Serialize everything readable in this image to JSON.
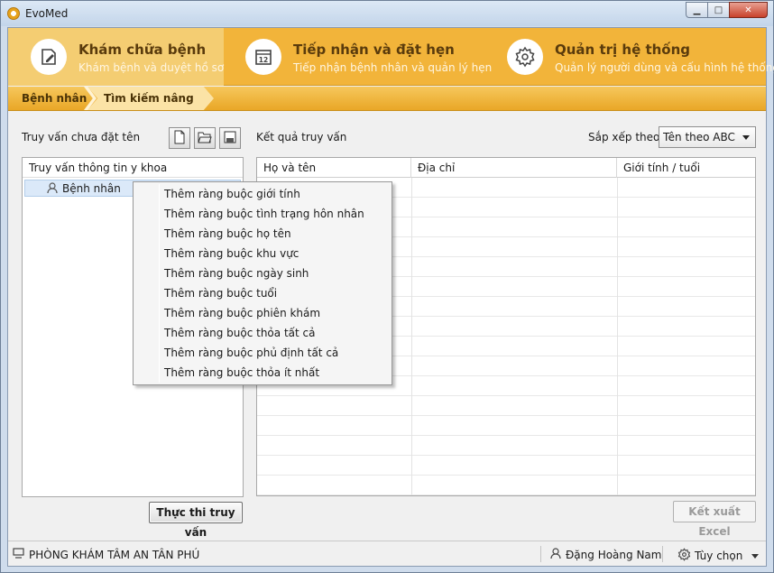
{
  "window": {
    "title": "EvoMed",
    "minimize": "▁",
    "maximize": "□",
    "close": "✕"
  },
  "modules": [
    {
      "title": "Khám chữa bệnh",
      "subtitle": "Khám bệnh và duyệt hồ sơ",
      "icon": "edit-document-icon",
      "active": true
    },
    {
      "title": "Tiếp nhận và đặt hẹn",
      "subtitle": "Tiếp nhận bệnh nhân và quản lý hẹn",
      "icon": "calendar-icon",
      "active": false
    },
    {
      "title": "Quản trị hệ thống",
      "subtitle": "Quản lý người dùng và cấu hình hệ thống",
      "icon": "gear-icon",
      "active": false
    }
  ],
  "breadcrumb": [
    "Bệnh nhân",
    "Tìm kiếm nâng cao"
  ],
  "left": {
    "query_label": "Truy vấn chưa đặt tên",
    "toolbar": {
      "new": "new-document-icon",
      "open": "open-folder-icon",
      "save": "save-icon"
    },
    "tree_header": "Truy vấn thông tin y khoa",
    "tree_node": "Bệnh nhân",
    "execute_button": "Thực thi truy vấn"
  },
  "right": {
    "results_label": "Kết quả truy vấn",
    "sort_label": "Sắp xếp theo:",
    "sort_value": "Tên theo ABC",
    "columns": [
      "Họ và tên",
      "Địa chỉ",
      "Giới tính / tuổi"
    ],
    "export_button": "Kết xuất Excel"
  },
  "context_menu": [
    "Thêm ràng buộc giới tính",
    "Thêm ràng buộc tình trạng hôn nhân",
    "Thêm ràng buộc họ tên",
    "Thêm ràng buộc khu vực",
    "Thêm ràng buộc ngày sinh",
    "Thêm ràng buộc tuổi",
    "Thêm ràng buộc phiên khám",
    "Thêm ràng buộc thỏa tất cả",
    "Thêm ràng buộc phủ định tất cả",
    "Thêm ràng buộc thỏa ít nhất"
  ],
  "status": {
    "clinic": "PHÒNG KHÁM TÂM AN TÂN PHÚ",
    "user": "Đặng Hoàng Nam",
    "options": "Tùy chọn"
  },
  "colors": {
    "accent": "#f2b43a",
    "active_module": "#f4cd72",
    "selection": "#dbe9f9"
  }
}
